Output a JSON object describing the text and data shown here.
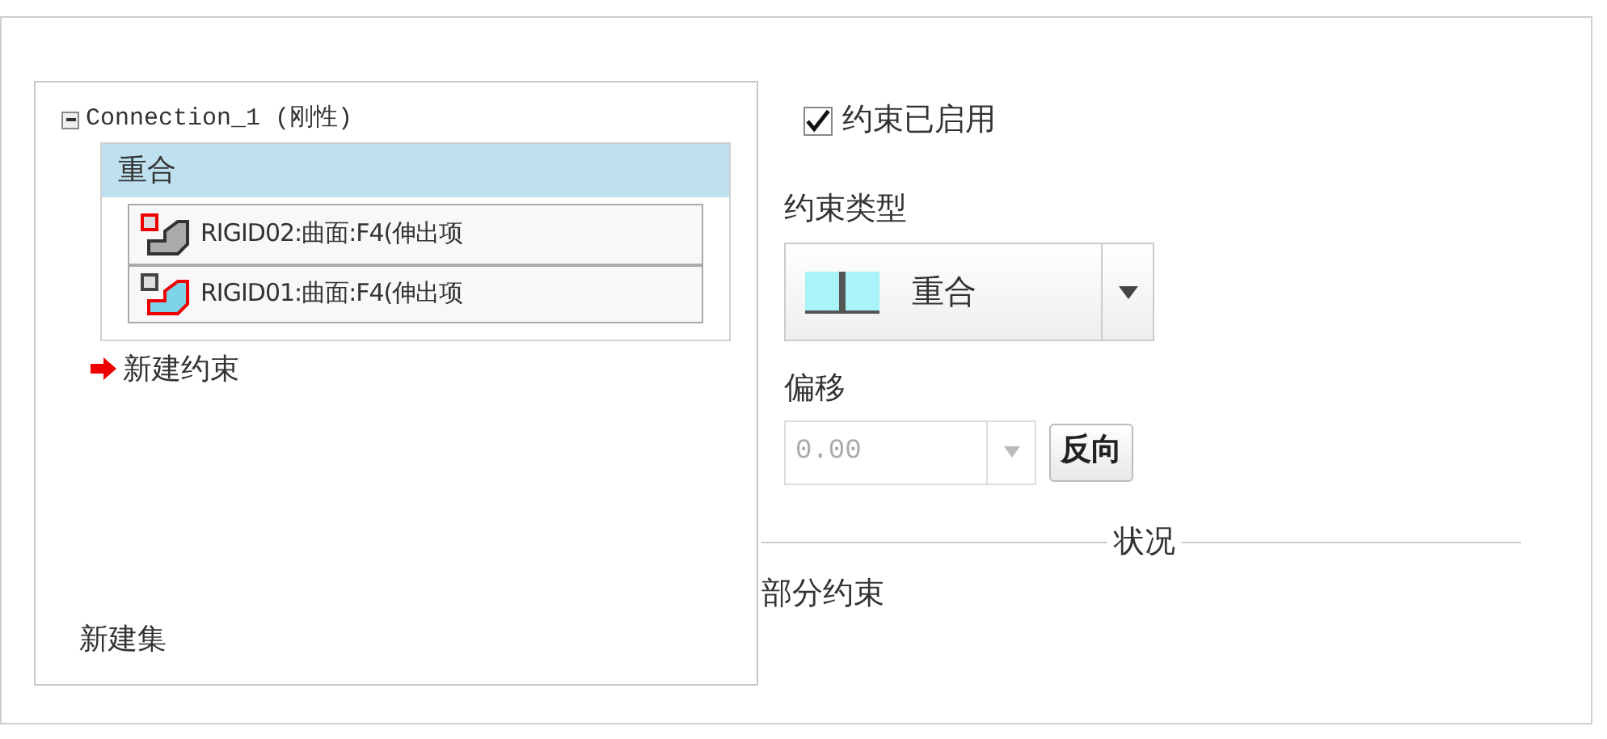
{
  "tree": {
    "label": "Connection_1 (刚性)",
    "expanded": true,
    "constraints": [
      {
        "label": "重合",
        "selected": true,
        "references": [
          {
            "label": "RIGID02:曲面:F4(伸出项",
            "kind": "surface_a"
          },
          {
            "label": "RIGID01:曲面:F4(伸出项",
            "kind": "surface_b"
          }
        ]
      }
    ],
    "new_constraint": "新建约束"
  },
  "new_set": "新建集",
  "enabled": {
    "label": "约束已启用",
    "checked": true
  },
  "constraint_type": {
    "label": "约束类型",
    "value": "重合"
  },
  "offset": {
    "label": "偏移",
    "value": "0.00",
    "disabled": true
  },
  "flip_button": "反向",
  "status": {
    "title": "状况",
    "text": "部分约束"
  }
}
